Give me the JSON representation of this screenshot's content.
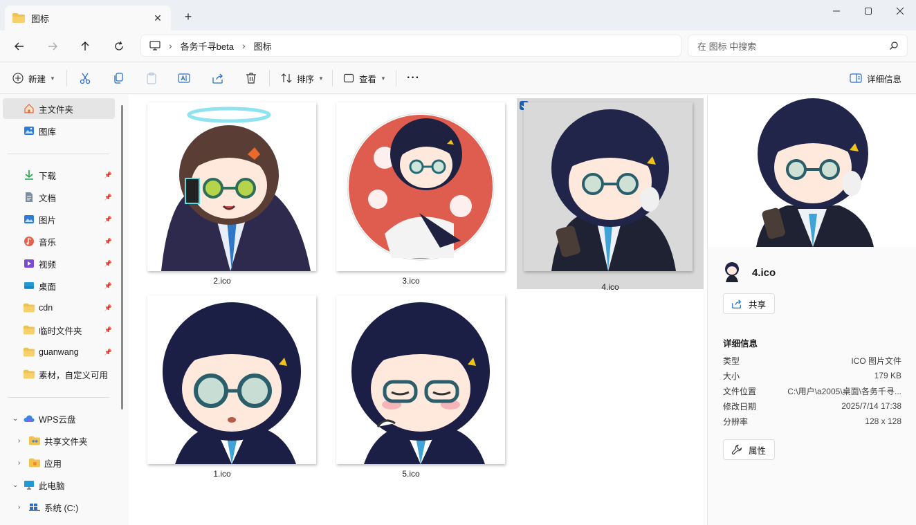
{
  "window": {
    "tab_title": "图标",
    "new_tab_symbol": "+",
    "close_tab_symbol": "✕"
  },
  "nav": {
    "breadcrumb": [
      "各务千寻beta",
      "图标"
    ],
    "search_placeholder": "在 图标 中搜索"
  },
  "toolbar": {
    "new_label": "新建",
    "sort_label": "排序",
    "view_label": "查看",
    "more_label": "···",
    "details_label": "详细信息"
  },
  "sidebar": {
    "quick": [
      {
        "label": "主文件夹",
        "icon": "home-icon",
        "selected": true
      },
      {
        "label": "图库",
        "icon": "gallery-icon"
      }
    ],
    "pinned": [
      {
        "label": "下载",
        "icon": "download-icon"
      },
      {
        "label": "文档",
        "icon": "document-icon"
      },
      {
        "label": "图片",
        "icon": "pictures-icon"
      },
      {
        "label": "音乐",
        "icon": "music-icon"
      },
      {
        "label": "视频",
        "icon": "video-icon"
      },
      {
        "label": "桌面",
        "icon": "desktop-icon"
      },
      {
        "label": "cdn",
        "icon": "folder-icon"
      },
      {
        "label": "临时文件夹",
        "icon": "folder-icon"
      },
      {
        "label": "guanwang",
        "icon": "folder-icon"
      },
      {
        "label": "素材，自定义可用",
        "icon": "folder-icon"
      }
    ],
    "tree": [
      {
        "label": "WPS云盘",
        "icon": "cloud-icon",
        "expanded": true
      },
      {
        "label": "共享文件夹",
        "icon": "shared-folder-icon",
        "expanded": false
      },
      {
        "label": "应用",
        "icon": "apps-folder-icon",
        "expanded": false
      },
      {
        "label": "此电脑",
        "icon": "computer-icon",
        "expanded": true
      },
      {
        "label": "系统 (C:)",
        "icon": "drive-icon",
        "expanded": false
      }
    ],
    "pin_symbol": "📌"
  },
  "files": [
    {
      "name": "2.ico",
      "selected": false,
      "hair": "#5a3e36",
      "bg": "#ffffff"
    },
    {
      "name": "3.ico",
      "selected": false,
      "hair": "#1e2140",
      "bg": "#d8412f"
    },
    {
      "name": "4.ico",
      "selected": true,
      "hair": "#22254a",
      "bg": "#d9d9d9"
    },
    {
      "name": "1.ico",
      "selected": false,
      "hair": "#1c1f45",
      "bg": "#ffffff"
    },
    {
      "name": "5.ico",
      "selected": false,
      "hair": "#1c1f45",
      "bg": "#ffffff"
    }
  ],
  "details": {
    "file_name": "4.ico",
    "share_label": "共享",
    "section_title": "详细信息",
    "rows": [
      {
        "key": "类型",
        "value": "ICO 图片文件"
      },
      {
        "key": "大小",
        "value": "179 KB"
      },
      {
        "key": "文件位置",
        "value": "C:\\用户\\a2005\\桌面\\各务千寻..."
      },
      {
        "key": "修改日期",
        "value": "2025/7/14 17:38"
      },
      {
        "key": "分辨率",
        "value": "128 x 128"
      }
    ],
    "properties_label": "属性"
  },
  "colors": {
    "accent": "#1a5fb4",
    "folder": "#f2c14e",
    "selected_tile": "#d9d9d9"
  }
}
